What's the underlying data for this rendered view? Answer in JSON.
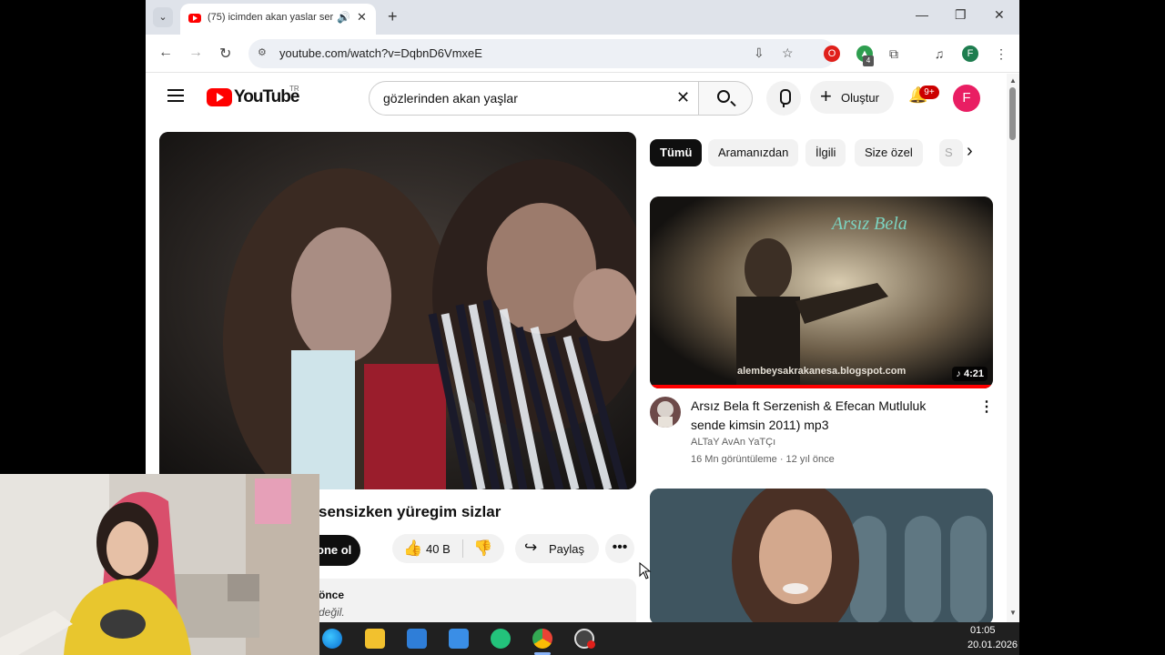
{
  "browser": {
    "tab_title": "(75) icimden akan yaslar ser",
    "new_tab_label": "+",
    "url": "youtube.com/watch?v=DqbnD6VmxeE",
    "profile_initial": "F",
    "extensions_badge": "4"
  },
  "youtube": {
    "logo_text": "YouTube",
    "region": "TR",
    "search_query": "gözlerinden akan yaşlar",
    "create_label": "Oluştur",
    "notifications_badge": "9+",
    "avatar_initial": "F",
    "video": {
      "title_partial": "sensizken yüregim sizlar",
      "subscribe_partial": "one ol",
      "likes": "40 B",
      "share_label": "Paylaş",
      "desc_line1": "önce",
      "desc_line2": "değil."
    },
    "chips": [
      "Tümü",
      "Aramanızdan",
      "İlgili",
      "Size özel",
      "S"
    ],
    "related": [
      {
        "title": "Arsız Bela ft Serzenish & Efecan Mutluluk sende kimsin 2011) mp3",
        "channel": "ALTaY AvAn YaTÇı",
        "meta": "16 Mn görüntüleme · 12 yıl önce",
        "duration": "4:21",
        "thumb_watermark": "alembeysakrakanesa.blogspot.com",
        "thumb_title": "Arsız Bela"
      }
    ]
  },
  "taskbar": {
    "time": "01:05",
    "date": "20.01.2026"
  },
  "colors": {
    "youtube_red": "#ff0000",
    "avatar_pink": "#e91e63",
    "badge_red": "#cc0000",
    "taskbar": "#202020"
  }
}
